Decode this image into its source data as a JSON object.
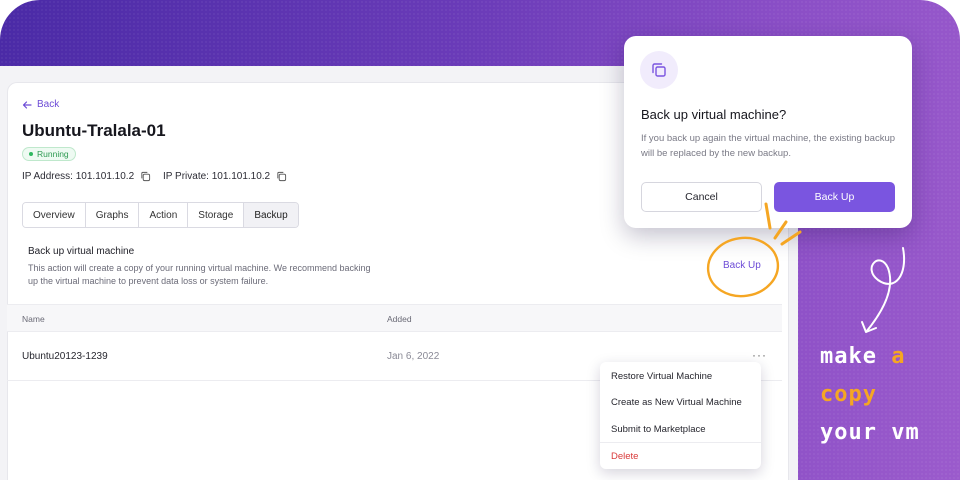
{
  "colors": {
    "accent": "#7a55e0",
    "status_green": "#2e9a52",
    "danger": "#d93a3a",
    "highlight_orange": "#f5a623"
  },
  "nav": {
    "back_label": "Back"
  },
  "vm": {
    "title": "Ubuntu-Tralala-01",
    "status": "Running",
    "ip_address_label": "IP Address:",
    "ip_address": "101.101.10.2",
    "ip_private_label": "IP Private:",
    "ip_private": "101.101.10.2"
  },
  "tabs": [
    {
      "label": "Overview"
    },
    {
      "label": "Graphs"
    },
    {
      "label": "Action"
    },
    {
      "label": "Storage"
    },
    {
      "label": "Backup",
      "active": true
    }
  ],
  "backup_section": {
    "title": "Back up virtual machine",
    "description": "This action will create a copy of your running virtual machine. We recommend backing up the virtual machine to prevent data loss or system failure.",
    "action_label": "Back Up"
  },
  "table": {
    "columns": [
      "Name",
      "Added"
    ],
    "rows": [
      {
        "name": "Ubuntu20123-1239",
        "added": "Jan 6, 2022"
      }
    ]
  },
  "row_menu": {
    "items": [
      "Restore Virtual Machine",
      "Create as New Virtual Machine",
      "Submit to Marketplace"
    ],
    "danger_item": "Delete"
  },
  "modal": {
    "icon": "copy-icon",
    "title": "Back up virtual machine?",
    "text": "If you back up again the virtual machine, the existing backup will be replaced by the new backup.",
    "cancel_label": "Cancel",
    "confirm_label": "Back Up"
  },
  "annotation": {
    "line1_a": "make",
    "line1_b": "a",
    "line2": "copy",
    "line3": "your vm"
  }
}
